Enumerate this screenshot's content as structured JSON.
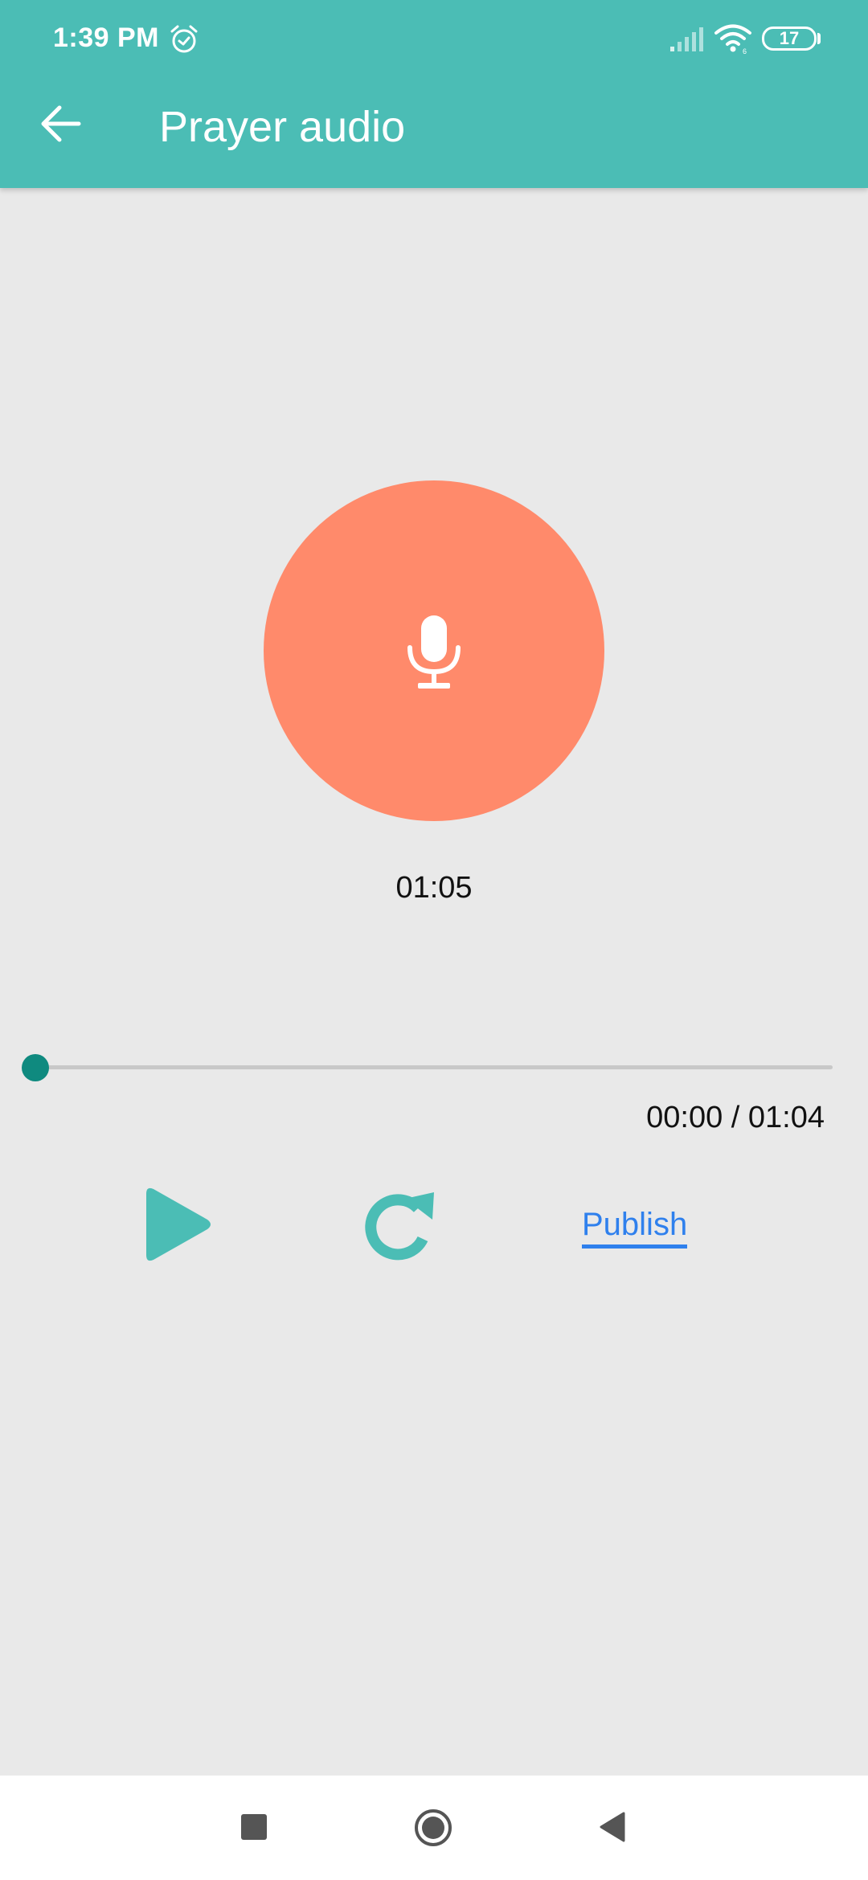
{
  "status_bar": {
    "time": "1:39 PM",
    "battery": "17",
    "icons": [
      "alarm-icon",
      "signal-icon",
      "wifi-icon",
      "battery-icon"
    ]
  },
  "app_bar": {
    "title": "Prayer audio",
    "back_icon": "arrow-left-icon"
  },
  "recorder": {
    "mic_icon": "microphone-icon",
    "elapsed": "01:05",
    "accent_color": "#ff8a6b"
  },
  "player": {
    "position_fraction": 0,
    "time_display": "00:00 / 01:04",
    "play_icon": "play-icon",
    "replay_icon": "replay-icon",
    "publish_label": "Publish"
  },
  "colors": {
    "primary": "#4bbdb5",
    "background": "#e9e9e9",
    "link": "#2f80ed",
    "seek_thumb": "#0f8a7f"
  },
  "nav_bar": {
    "icons": [
      "recent-apps-icon",
      "home-icon",
      "back-icon"
    ]
  }
}
